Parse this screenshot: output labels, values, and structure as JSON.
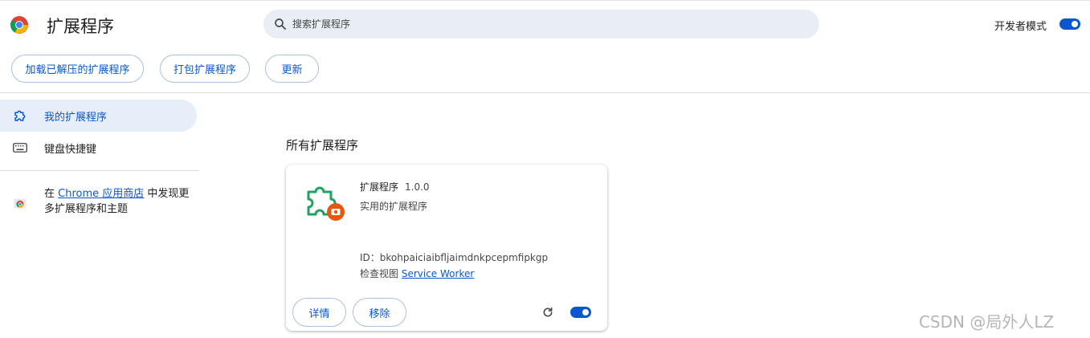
{
  "header": {
    "title": "扩展程序",
    "logo_icon": "chrome-logo-icon",
    "search": {
      "placeholder": "搜索扩展程序",
      "value": ""
    },
    "dev_mode": {
      "label": "开发者模式",
      "enabled": true
    }
  },
  "toolbar": {
    "load_unpacked": "加载已解压的扩展程序",
    "pack": "打包扩展程序",
    "update": "更新"
  },
  "sidebar": {
    "items": [
      {
        "label": "我的扩展程序",
        "icon": "puzzle-icon",
        "active": true
      },
      {
        "label": "键盘快捷键",
        "icon": "keyboard-icon",
        "active": false
      }
    ],
    "store": {
      "prefix": "在",
      "link": "Chrome 应用商店",
      "suffix": "中发现更多扩展程序和主题"
    }
  },
  "main": {
    "section_title": "所有扩展程序",
    "extensions": [
      {
        "name": "扩展程序",
        "version": "1.0.0",
        "description": "实用的扩展程序",
        "id_label": "ID：",
        "id": "bkohpaiciaibfljaimdnkpcepmfipkgp",
        "inspect_label": "检查视图",
        "inspect_link": "Service Worker",
        "details_button": "详情",
        "remove_button": "移除",
        "enabled": true
      }
    ]
  },
  "watermark": "CSDN @局外人LZ",
  "colors": {
    "accent": "#0b57d0",
    "active_bg": "#e6eef9",
    "search_bg": "#e9eef6",
    "ext_green": "#1ea362",
    "ext_badge": "#e8580c"
  }
}
